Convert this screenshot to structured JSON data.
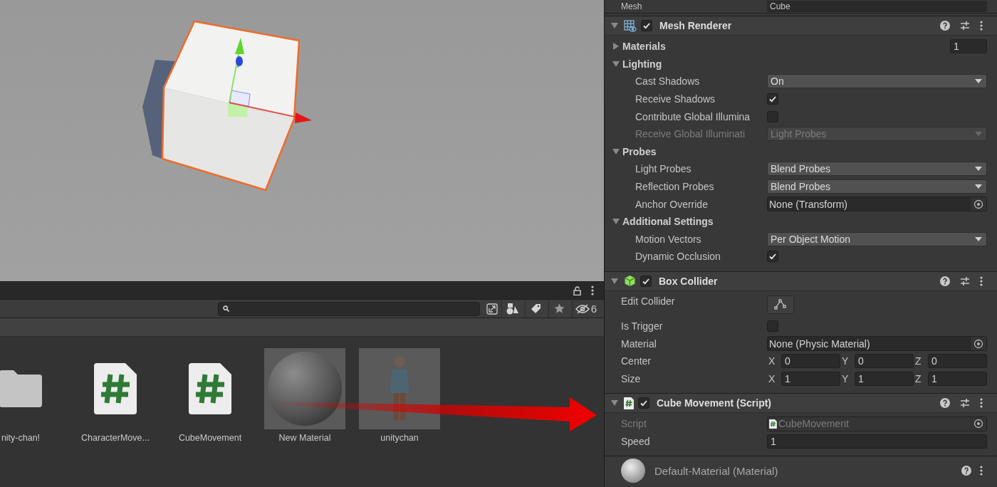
{
  "project": {
    "hidden_count": "6",
    "items": [
      {
        "name": "nity-chan!",
        "kind": "folder"
      },
      {
        "name": "CharacterMove...",
        "kind": "script"
      },
      {
        "name": "CubeMovement",
        "kind": "script"
      },
      {
        "name": "New Material",
        "kind": "material"
      },
      {
        "name": "unitychan",
        "kind": "model"
      }
    ]
  },
  "inspector": {
    "mesh_row": {
      "label": "Mesh",
      "value": "Cube"
    },
    "components": [
      {
        "title": "Mesh Renderer",
        "enabled": true,
        "expanded": true,
        "rows": [
          {
            "kind": "foldout",
            "label": "Materials",
            "expanded": false,
            "count": "1"
          },
          {
            "kind": "foldout",
            "label": "Lighting",
            "expanded": true,
            "children": [
              {
                "kind": "dropdown",
                "label": "Cast Shadows",
                "value": "On",
                "disabled": false
              },
              {
                "kind": "checkbox",
                "label": "Receive Shadows",
                "checked": true,
                "disabled": false
              },
              {
                "kind": "checkbox",
                "label": "Contribute Global Illumina",
                "checked": false,
                "disabled": false
              },
              {
                "kind": "dropdown",
                "label": "Receive Global Illuminati",
                "value": "Light Probes",
                "disabled": true
              }
            ]
          },
          {
            "kind": "foldout",
            "label": "Probes",
            "expanded": true,
            "children": [
              {
                "kind": "dropdown",
                "label": "Light Probes",
                "value": "Blend Probes",
                "disabled": false
              },
              {
                "kind": "dropdown",
                "label": "Reflection Probes",
                "value": "Blend Probes",
                "disabled": false
              },
              {
                "kind": "object",
                "label": "Anchor Override",
                "value": "None (Transform)",
                "disabled": false
              }
            ]
          },
          {
            "kind": "foldout",
            "label": "Additional Settings",
            "expanded": true,
            "children": [
              {
                "kind": "dropdown",
                "label": "Motion Vectors",
                "value": "Per Object Motion",
                "disabled": false
              },
              {
                "kind": "checkbox",
                "label": "Dynamic Occlusion",
                "checked": true,
                "disabled": false
              }
            ]
          }
        ]
      },
      {
        "title": "Box Collider",
        "enabled": true,
        "expanded": true,
        "rows": [
          {
            "kind": "button",
            "label": "Edit Collider",
            "disabled": false
          },
          {
            "kind": "checkbox",
            "label": "Is Trigger",
            "checked": false,
            "disabled": false
          },
          {
            "kind": "object",
            "label": "Material",
            "value": "None (Physic Material)",
            "disabled": false
          },
          {
            "kind": "vector3",
            "label": "Center",
            "disabled": false,
            "values": [
              {
                "axis": "X",
                "value": "0"
              },
              {
                "axis": "Y",
                "value": "0"
              },
              {
                "axis": "Z",
                "value": "0"
              }
            ]
          },
          {
            "kind": "vector3",
            "label": "Size",
            "disabled": false,
            "values": [
              {
                "axis": "X",
                "value": "1"
              },
              {
                "axis": "Y",
                "value": "1"
              },
              {
                "axis": "Z",
                "value": "1"
              }
            ]
          }
        ]
      },
      {
        "title": "Cube Movement (Script)",
        "enabled": true,
        "expanded": true,
        "rows": [
          {
            "kind": "script",
            "label": "Script",
            "value": "CubeMovement",
            "disabled": true
          },
          {
            "kind": "number",
            "label": "Speed",
            "value": "1",
            "disabled": false
          }
        ]
      }
    ],
    "material_preview": {
      "title": "Default-Material (Material)"
    }
  }
}
